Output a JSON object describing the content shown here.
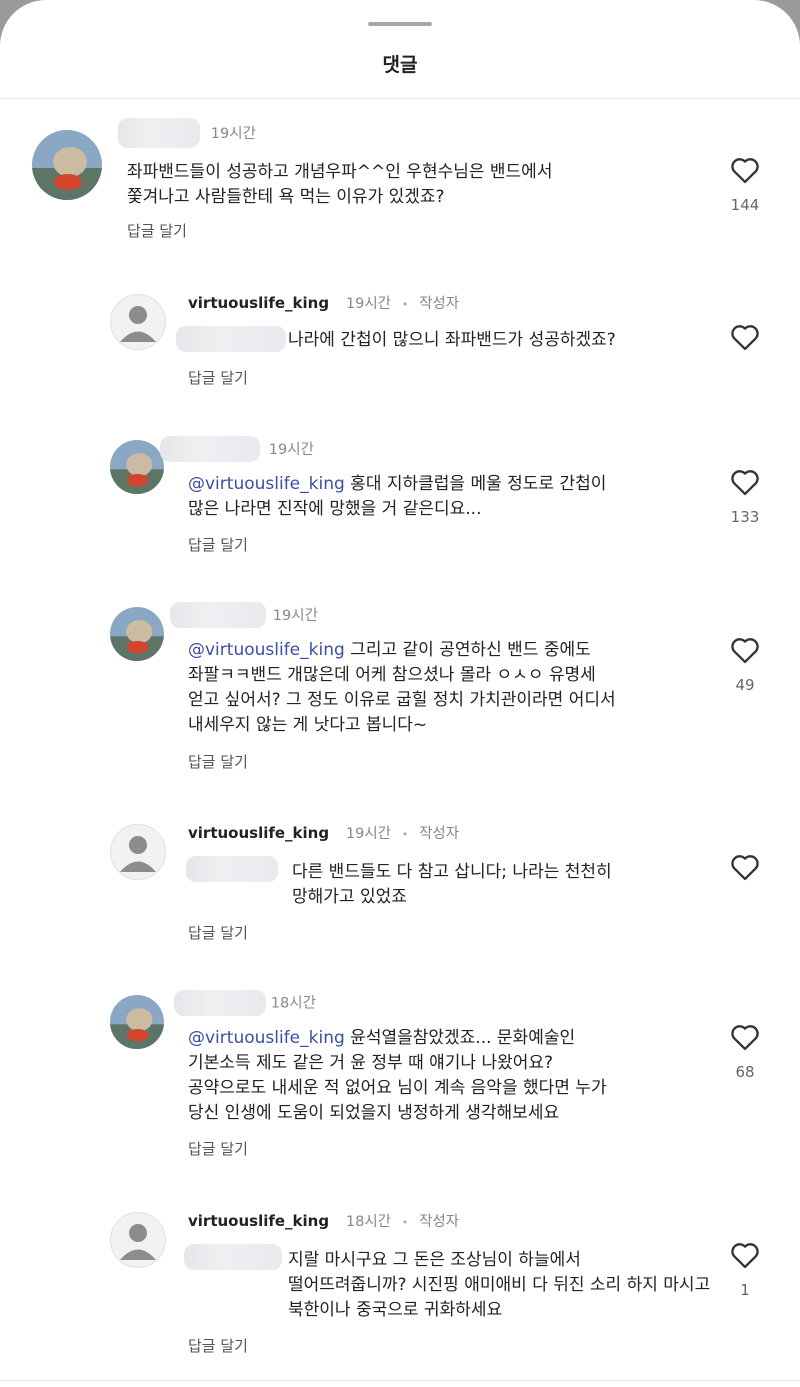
{
  "header": {
    "title": "댓글"
  },
  "comments": [
    {
      "time": "19시간",
      "text": "좌파밴드들이 성공하고 개념우파^^인 우현수님은 밴드에서\n쫓겨나고 사람들한테 욕 먹는 이유가 있겠죠?",
      "reply_label": "답글 달기",
      "likes": "144"
    },
    {
      "user": "virtuouslife_king",
      "time": "19시간",
      "author_badge": "작성자",
      "text": "나라에 간첩이 많으니 좌파밴드가 성공하겠죠?",
      "reply_label": "답글 달기"
    },
    {
      "time": "19시간",
      "mention": "@virtuouslife_king",
      "text": " 홍대 지하클럽을 메울 정도로 간첩이\n많은 나라면 진작에 망했을 거 같은디요...",
      "reply_label": "답글 달기",
      "likes": "133"
    },
    {
      "time": "19시간",
      "mention": "@virtuouslife_king",
      "text": " 그리고 같이 공연하신 밴드 중에도\n좌팔ㅋㅋ밴드 개많은데 어케 참으셨나 몰라 ㅇㅅㅇ 유명세\n얻고 싶어서? 그 정도 이유로 굽힐 정치 가치관이라면 어디서\n내세우지 않는 게 낫다고 봅니다~",
      "reply_label": "답글 달기",
      "likes": "49"
    },
    {
      "user": "virtuouslife_king",
      "time": "19시간",
      "author_badge": "작성자",
      "text": "다른 밴드들도 다 참고 삽니다; 나라는 천천히\n망해가고 있었죠",
      "reply_label": "답글 달기"
    },
    {
      "time": "18시간",
      "mention": "@virtuouslife_king",
      "text": " 윤석열을참았겠죠... 문화예술인\n기본소득 제도 같은 거 윤 정부 때 얘기나 나왔어요?\n공약으로도 내세운 적 없어요 님이 계속 음악을 했다면 누가\n당신 인생에 도움이 되었을지 냉정하게 생각해보세요",
      "reply_label": "답글 달기",
      "likes": "68"
    },
    {
      "user": "virtuouslife_king",
      "time": "18시간",
      "author_badge": "작성자",
      "text": "지랄 마시구요 그 돈은 조상님이 하늘에서\n떨어뜨려줍니까? 시진핑 애미애비 다 뒤진 소리 하지 마시고\n북한이나 중국으로 귀화하세요",
      "reply_label": "답글 달기",
      "likes": "1"
    }
  ],
  "icons": {
    "like": "heart-outline-icon",
    "default_avatar": "person-silhouette-icon",
    "photo_avatar": "photo-avatar"
  },
  "colors": {
    "mention": "#3a4fa3",
    "meta": "#888888",
    "heart": "#333333"
  }
}
